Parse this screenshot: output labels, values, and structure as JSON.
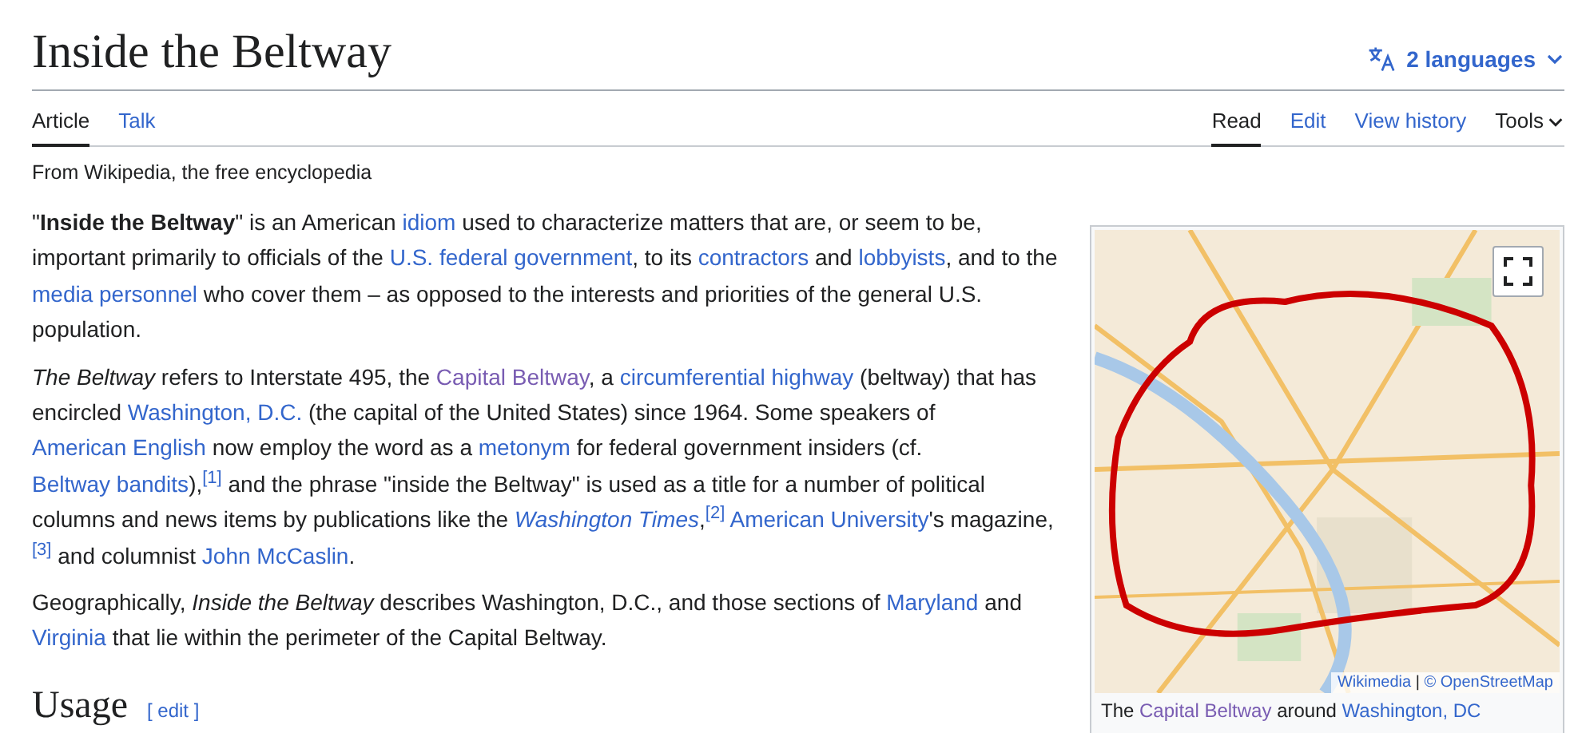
{
  "title": "Inside the Beltway",
  "languages": {
    "label": "2 languages"
  },
  "tabs_left": [
    {
      "label": "Article",
      "selected": true
    },
    {
      "label": "Talk",
      "selected": false
    }
  ],
  "tabs_right": [
    {
      "label": "Read",
      "selected": true,
      "kind": "tab"
    },
    {
      "label": "Edit",
      "selected": false,
      "kind": "tab"
    },
    {
      "label": "View history",
      "selected": false,
      "kind": "tab"
    },
    {
      "label": "Tools",
      "selected": false,
      "kind": "menu"
    }
  ],
  "tagline": "From Wikipedia, the free encyclopedia",
  "paragraphs": [
    [
      {
        "kind": "text",
        "text": "\""
      },
      {
        "kind": "bold",
        "text": "Inside the Beltway"
      },
      {
        "kind": "text",
        "text": "\" is an American "
      },
      {
        "kind": "link",
        "text": "idiom"
      },
      {
        "kind": "text",
        "text": " used to characterize matters that are, or seem to be, important primarily to officials of the "
      },
      {
        "kind": "link",
        "text": "U.S. federal government"
      },
      {
        "kind": "text",
        "text": ", to its "
      },
      {
        "kind": "link",
        "text": "contractors"
      },
      {
        "kind": "text",
        "text": " and "
      },
      {
        "kind": "link",
        "text": "lobbyists"
      },
      {
        "kind": "text",
        "text": ", and to the "
      },
      {
        "kind": "link",
        "text": "media personnel"
      },
      {
        "kind": "text",
        "text": " who cover them – as opposed to the interests and priorities of the general U.S. population."
      }
    ],
    [
      {
        "kind": "italic",
        "text": "The Beltway"
      },
      {
        "kind": "text",
        "text": " refers to Interstate 495, the "
      },
      {
        "kind": "visited",
        "text": "Capital Beltway"
      },
      {
        "kind": "text",
        "text": ", a "
      },
      {
        "kind": "link",
        "text": "circumferential highway"
      },
      {
        "kind": "text",
        "text": " (beltway) that has encircled "
      },
      {
        "kind": "link",
        "text": "Washington, D.C."
      },
      {
        "kind": "text",
        "text": " (the capital of the United States) since 1964. Some speakers of "
      },
      {
        "kind": "link",
        "text": "American "
      },
      {
        "kind": "link",
        "text": "English"
      },
      {
        "kind": "text",
        "text": " now employ the word as a "
      },
      {
        "kind": "link",
        "text": "metonym"
      },
      {
        "kind": "text",
        "text": " for federal government insiders (cf. "
      },
      {
        "kind": "link",
        "text": "Beltway bandits"
      },
      {
        "kind": "text",
        "text": "),"
      },
      {
        "kind": "ref",
        "text": "[1]"
      },
      {
        "kind": "text",
        "text": " and the phrase \"inside the Beltway\" is used as a title for a number of political columns and news items by publications like the "
      },
      {
        "kind": "italic-link",
        "text": "Washington Times"
      },
      {
        "kind": "text",
        "text": ","
      },
      {
        "kind": "ref",
        "text": "[2]"
      },
      {
        "kind": "link",
        "text": " American University"
      },
      {
        "kind": "text",
        "text": "'s magazine,"
      },
      {
        "kind": "ref",
        "text": "[3]"
      },
      {
        "kind": "text",
        "text": " and columnist "
      },
      {
        "kind": "link",
        "text": "John "
      },
      {
        "kind": "link",
        "text": "McCaslin"
      },
      {
        "kind": "text",
        "text": "."
      }
    ],
    [
      {
        "kind": "text",
        "text": "Geographically, "
      },
      {
        "kind": "italic",
        "text": "Inside the Beltway"
      },
      {
        "kind": "text",
        "text": " describes Washington, D.C., and those sections of "
      },
      {
        "kind": "link",
        "text": "Maryland"
      },
      {
        "kind": "text",
        "text": " and "
      },
      {
        "kind": "link",
        "text": "Virginia"
      },
      {
        "kind": "text",
        "text": " that lie within the perimeter of the Capital Beltway."
      }
    ]
  ],
  "section": {
    "heading": "Usage",
    "edit": "[ edit ]"
  },
  "infobox": {
    "attribution": [
      {
        "kind": "link",
        "text": "Wikimedia"
      },
      {
        "kind": "text",
        "text": " | "
      },
      {
        "kind": "link",
        "text": "© OpenStreetMap"
      }
    ],
    "caption": [
      {
        "kind": "text",
        "text": "The "
      },
      {
        "kind": "visited",
        "text": "Capital Beltway"
      },
      {
        "kind": "text",
        "text": " around "
      },
      {
        "kind": "link",
        "text": "Washington, DC"
      }
    ]
  }
}
